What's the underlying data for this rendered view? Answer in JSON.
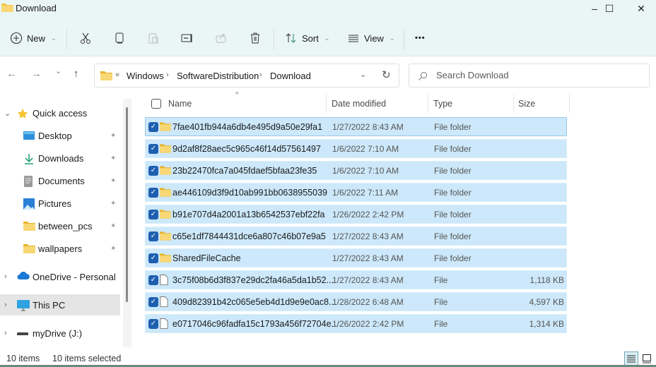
{
  "window": {
    "title": "Download",
    "controls": {
      "minimize": "–",
      "maximize": "☐",
      "close": "✕"
    }
  },
  "toolbar": {
    "new_label": "New",
    "sort_label": "Sort",
    "view_label": "View",
    "more_label": "•••",
    "icons": [
      "plus-circle-icon",
      "cut-icon",
      "copy-icon",
      "paste-icon",
      "rename-icon",
      "share-icon",
      "delete-icon",
      "sort-icon",
      "view-lines-icon",
      "more-icon"
    ]
  },
  "nav": {
    "back": "←",
    "forward": "→",
    "recent": "⌄",
    "up": "↑",
    "breadcrumb_overflow": "«",
    "breadcrumb": [
      "Windows",
      "SoftwareDistribution",
      "Download"
    ],
    "search_placeholder": "Search Download"
  },
  "sidebar": {
    "items": [
      {
        "label": "Quick access",
        "icon": "star-icon",
        "expand": "⌄",
        "pinned": false
      },
      {
        "label": "Desktop",
        "icon": "desktop-icon",
        "pinned": true
      },
      {
        "label": "Downloads",
        "icon": "download-icon",
        "pinned": true
      },
      {
        "label": "Documents",
        "icon": "document-icon",
        "pinned": true
      },
      {
        "label": "Pictures",
        "icon": "pictures-icon",
        "pinned": true
      },
      {
        "label": "between_pcs",
        "icon": "folder-icon",
        "pinned": true
      },
      {
        "label": "wallpapers",
        "icon": "folder-icon",
        "pinned": true
      },
      {
        "label": "OneDrive - Personal",
        "icon": "cloud-icon",
        "expand": "›",
        "pinned": false
      },
      {
        "label": "This PC",
        "icon": "monitor-icon",
        "expand": "›",
        "pinned": false,
        "selected": true
      },
      {
        "label": "myDrive (J:)",
        "icon": "drive-icon",
        "expand": "›",
        "pinned": false
      }
    ],
    "pin_glyph": "📌"
  },
  "columns": {
    "name": "Name",
    "date": "Date modified",
    "type": "Type",
    "size": "Size",
    "sort_glyph": "^"
  },
  "files": [
    {
      "name": "7fae401fb944a6db4e495d9a50e29fa1",
      "date": "1/27/2022 8:43 AM",
      "type": "File folder",
      "size": "",
      "kind": "folder",
      "checked": true
    },
    {
      "name": "9d2af8f28aec5c965c46f14d57561497",
      "date": "1/6/2022 7:10 AM",
      "type": "File folder",
      "size": "",
      "kind": "folder",
      "checked": true
    },
    {
      "name": "23b22470fca7a045fdaef5bfaa23fe35",
      "date": "1/6/2022 7:10 AM",
      "type": "File folder",
      "size": "",
      "kind": "folder",
      "checked": true
    },
    {
      "name": "ae446109d3f9d10ab991bb0638955039",
      "date": "1/6/2022 7:11 AM",
      "type": "File folder",
      "size": "",
      "kind": "folder",
      "checked": true
    },
    {
      "name": "b91e707d4a2001a13b6542537ebf22fa",
      "date": "1/26/2022 2:42 PM",
      "type": "File folder",
      "size": "",
      "kind": "folder",
      "checked": true
    },
    {
      "name": "c65e1df7844431dce6a807c46b07e9a5",
      "date": "1/27/2022 8:43 AM",
      "type": "File folder",
      "size": "",
      "kind": "folder",
      "checked": true
    },
    {
      "name": "SharedFileCache",
      "date": "1/27/2022 8:43 AM",
      "type": "File folder",
      "size": "",
      "kind": "folder",
      "checked": true
    },
    {
      "name": "3c75f08b6d3f837e29dc2fa46a5da1b52...",
      "date": "1/27/2022 8:43 AM",
      "type": "File",
      "size": "1,118 KB",
      "kind": "file",
      "checked": true
    },
    {
      "name": "409d82391b42c065e5eb4d1d9e9e0ac8...",
      "date": "1/28/2022 6:48 AM",
      "type": "File",
      "size": "4,597 KB",
      "kind": "file",
      "checked": true
    },
    {
      "name": "e0717046c96fadfa15c1793a456f72704e...",
      "date": "1/26/2022 2:42 PM",
      "type": "File",
      "size": "1,314 KB",
      "kind": "file",
      "checked": true
    }
  ],
  "status": {
    "count": "10 items",
    "selected": "10 items selected"
  },
  "colors": {
    "selection": "#cce8fa",
    "checkbox": "#1e5fb0",
    "chrome": "#eaf5f6",
    "folder": "#f5c542"
  }
}
